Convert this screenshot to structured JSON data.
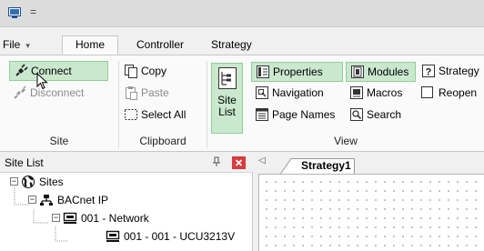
{
  "qat_symbol": "=",
  "menu": {
    "file": "File",
    "file_caret": "▾",
    "tabs": [
      "Home",
      "Controller",
      "Strategy"
    ]
  },
  "ribbon": {
    "site": {
      "connect": "Connect",
      "disconnect": "Disconnect",
      "label": "Site"
    },
    "clipboard": {
      "copy": "Copy",
      "paste": "Paste",
      "select_all": "Select All",
      "label": "Clipboard"
    },
    "view": {
      "site_list_line1": "Site",
      "site_list_line2": "List",
      "properties": "Properties",
      "navigation": "Navigation",
      "page_names": "Page Names",
      "modules": "Modules",
      "macros": "Macros",
      "search": "Search",
      "strategy": "Strategy",
      "reopen": "Reopen",
      "label": "View"
    }
  },
  "site_list_pane": {
    "title": "Site List",
    "close_glyph": "×",
    "tree": [
      "Sites",
      "BACnet IP",
      "001 - Network",
      "001 - 001 - UCU3213V"
    ]
  },
  "document": {
    "nav_arrow": "◁",
    "tab_label": "Strategy1"
  },
  "colors": {
    "highlight": "#c9e8cd",
    "highlight_border": "#8fcf98",
    "close_red": "#d83b3b"
  }
}
